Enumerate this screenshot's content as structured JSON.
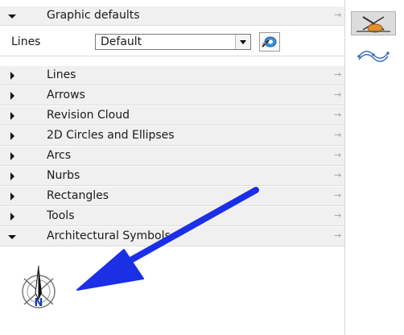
{
  "panel": {
    "header": {
      "label": "Graphic defaults",
      "expanded": true
    },
    "lines_bar": {
      "label": "Lines",
      "select_value": "Default"
    },
    "sections": [
      {
        "label": "Lines",
        "expanded": false
      },
      {
        "label": "Arrows",
        "expanded": false
      },
      {
        "label": "Revision Cloud",
        "expanded": false
      },
      {
        "label": "2D Circles and Ellipses",
        "expanded": false
      },
      {
        "label": "Arcs",
        "expanded": false
      },
      {
        "label": "Nurbs",
        "expanded": false
      },
      {
        "label": "Rectangles",
        "expanded": false
      },
      {
        "label": "Tools",
        "expanded": false
      },
      {
        "label": "Architectural Symbols",
        "expanded": true
      }
    ],
    "pin_glyph": "→",
    "north_label": "N"
  },
  "icons": {
    "expand": "triangle-right-icon",
    "collapse": "triangle-down-icon",
    "pin": "pin-arrow-icon",
    "settings": "line-settings-icon",
    "tool1": "line-tool-icon",
    "tool2": "curve-tool-icon",
    "north": "north-arrow-icon"
  },
  "colors": {
    "row_bg": "#f0f0f0",
    "annotation_arrow": "#1a2fe6",
    "north_letter": "#1a3da8"
  }
}
